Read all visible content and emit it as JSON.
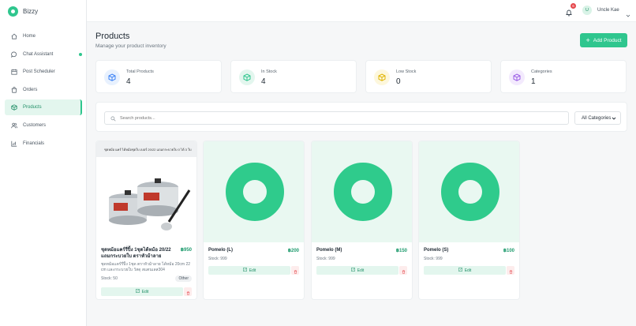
{
  "app": {
    "name": "Bizzy",
    "accent": "#2fc68e"
  },
  "sidebar": {
    "items": [
      {
        "label": "Home",
        "icon": "home-icon",
        "active": false
      },
      {
        "label": "Chat Assistant",
        "icon": "chat-icon",
        "active": false
      },
      {
        "label": "Post Scheduler",
        "icon": "calendar-icon",
        "active": false
      },
      {
        "label": "Orders",
        "icon": "orders-icon",
        "active": false
      },
      {
        "label": "Products",
        "icon": "box-icon",
        "active": true
      },
      {
        "label": "Customers",
        "icon": "users-icon",
        "active": false
      },
      {
        "label": "Financials",
        "icon": "chart-icon",
        "active": false
      }
    ]
  },
  "header": {
    "notification_count": "6",
    "user_initial": "U",
    "user_name": "Uncle Kae"
  },
  "page": {
    "title": "Products",
    "subtitle": "Manage your product inventory",
    "add_button": "Add Product"
  },
  "stats": [
    {
      "label": "Total Products",
      "value": "4",
      "color": "#3b82f6",
      "bg": "#e8f1fe"
    },
    {
      "label": "In Stock",
      "value": "4",
      "color": "#2fc68e",
      "bg": "#e3f6ee"
    },
    {
      "label": "Low Stock",
      "value": "0",
      "color": "#e0b400",
      "bg": "#fdf7dc"
    },
    {
      "label": "Categories",
      "value": "1",
      "color": "#9b5de5",
      "bg": "#f3eafd"
    }
  ],
  "search": {
    "placeholder": "Search products...",
    "category_selected": "All Categories"
  },
  "products": [
    {
      "name": "ชุดหม้อแคร์รี่ปิ้ง 1ชุดได้หม้อ 20/22 แถมกระบวยใบ ตราหัวม้าลาย",
      "price": "฿950",
      "description": "ชุดหม้อแคร์รี่ปิ้ง 1ชุด ตราหัวม้าลาย ได้หม้อ 20cm 22 cm และกระบวยใบ วัสดุ สแตนเลส304",
      "stock": "Stock: 50",
      "tag": "Other",
      "banner": "ชุดหม้อ แคร์ ได้หม้อชุดใบ เบอร์ 20/22 แถมกระบวยใบ 0 ได้ 3 ใบ",
      "edit_label": "Edit"
    },
    {
      "name": "Pomelo (L)",
      "price": "฿200",
      "stock": "Stock: 999",
      "edit_label": "Edit"
    },
    {
      "name": "Pomelo (M)",
      "price": "฿150",
      "stock": "Stock: 999",
      "edit_label": "Edit"
    },
    {
      "name": "Pomelo (S)",
      "price": "฿100",
      "stock": "Stock: 999",
      "edit_label": "Edit"
    }
  ]
}
